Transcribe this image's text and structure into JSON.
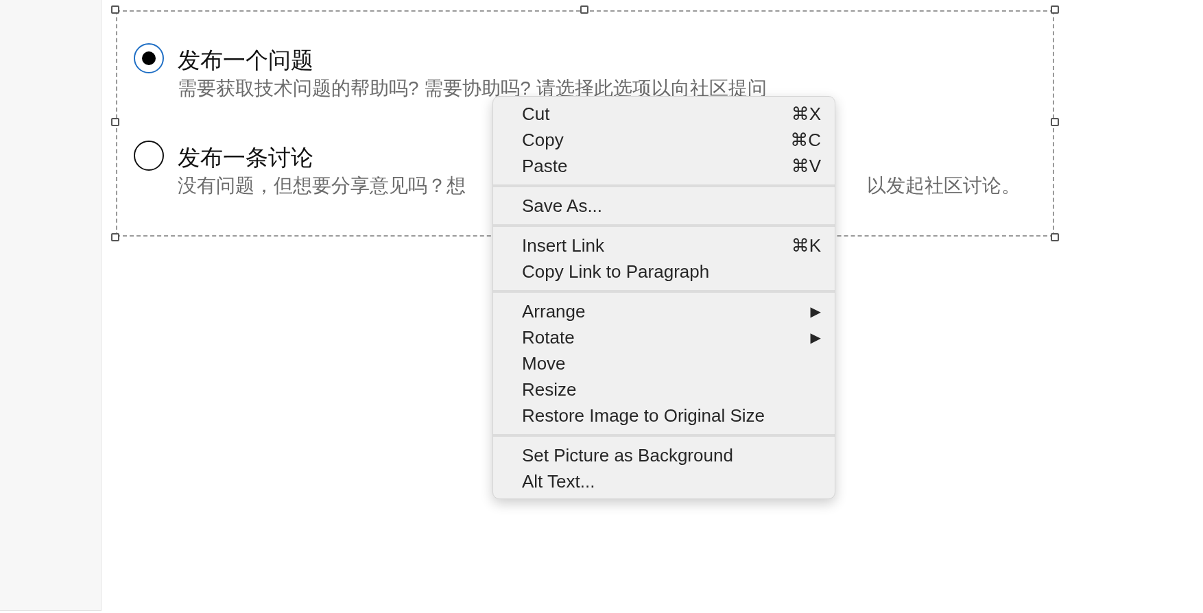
{
  "options": [
    {
      "title": "发布一个问题",
      "description": [
        "需要获取技术问题的帮助吗? 需要协助吗? 请选择此选项以向社区提问"
      ],
      "selected": true
    },
    {
      "title": "发布一条讨论",
      "description": [
        "没有问题，但想要分享意见吗？想",
        "以发起社区讨论。"
      ],
      "selected": false
    }
  ],
  "context_menu": {
    "groups": [
      [
        {
          "label": "Cut",
          "shortcut": "⌘X"
        },
        {
          "label": "Copy",
          "shortcut": "⌘C"
        },
        {
          "label": "Paste",
          "shortcut": "⌘V"
        }
      ],
      [
        {
          "label": "Save As..."
        }
      ],
      [
        {
          "label": "Insert Link",
          "shortcut": "⌘K"
        },
        {
          "label": "Copy Link to Paragraph"
        }
      ],
      [
        {
          "label": "Arrange",
          "submenu": "▶"
        },
        {
          "label": "Rotate",
          "submenu": "▶"
        },
        {
          "label": "Move"
        },
        {
          "label": "Resize"
        },
        {
          "label": "Restore Image to Original Size"
        }
      ],
      [
        {
          "label": "Set Picture as Background"
        },
        {
          "label": "Alt Text..."
        }
      ]
    ]
  }
}
